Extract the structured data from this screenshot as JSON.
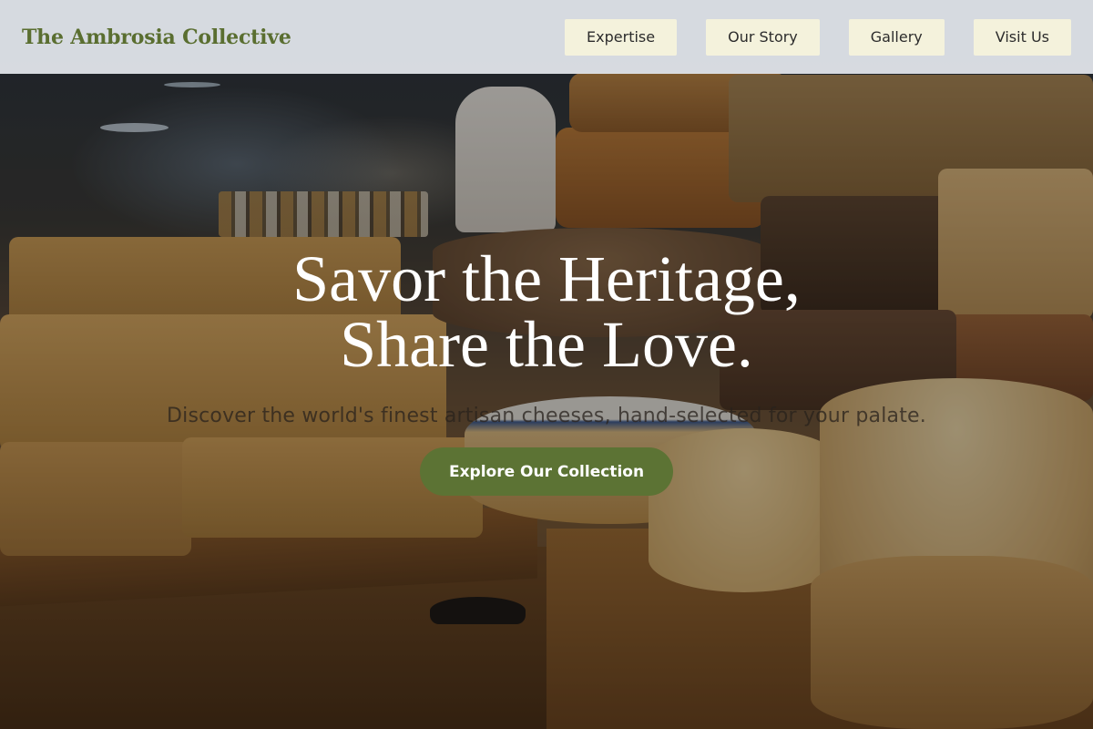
{
  "header": {
    "brand": "The Ambrosia Collective",
    "nav": [
      {
        "label": "Expertise"
      },
      {
        "label": "Our Story"
      },
      {
        "label": "Gallery"
      },
      {
        "label": "Visit Us"
      }
    ]
  },
  "hero": {
    "headline_line1": "Savor the Heritage,",
    "headline_line2": "Share the Love.",
    "subtitle": "Discover the world's finest artisan cheeses, hand-selected for your palate.",
    "cta_label": "Explore Our Collection",
    "background_image": "cheese-shop-photo"
  },
  "colors": {
    "brand": "#5a6e30",
    "cta": "#5c7334",
    "nav_button_bg": "#f4f2dc",
    "header_bg": "#e2e6ec"
  }
}
